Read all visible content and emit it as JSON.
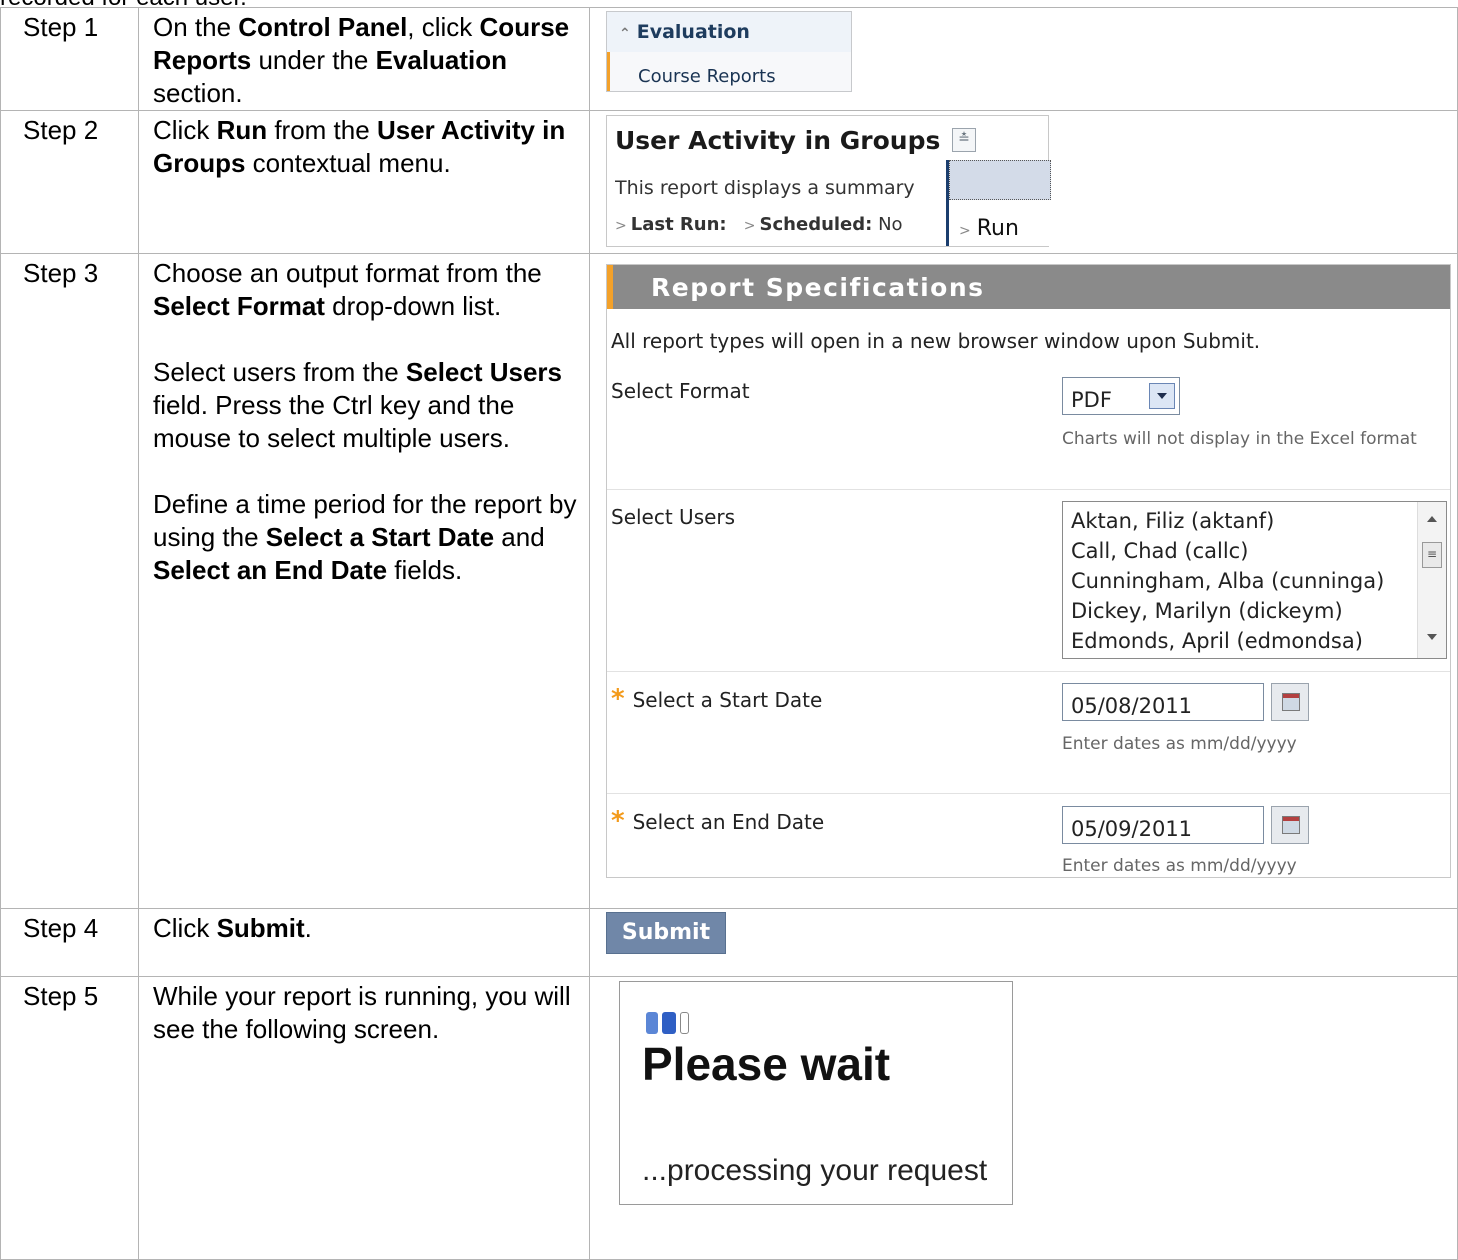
{
  "cut_line": "recorded for each user.",
  "steps": [
    {
      "label": "Step 1",
      "instruction": [
        "On the ",
        {
          "b": "Control Panel"
        },
        ", click ",
        {
          "b": "Course Reports"
        },
        " under the ",
        {
          "b": "Evaluation"
        },
        " section."
      ]
    },
    {
      "label": "Step 2",
      "instruction": [
        "Click ",
        {
          "b": "Run"
        },
        " from the ",
        {
          "b": "User Activity in Groups"
        },
        " contextual menu."
      ]
    },
    {
      "label": "Step 3",
      "paragraphs": [
        [
          "Choose an output format from the ",
          {
            "b": "Select Format"
          },
          " drop-down list."
        ],
        [
          "Select users from the ",
          {
            "b": "Select Users"
          },
          " field. Press the Ctrl key and the mouse to select multiple users."
        ],
        [
          "Define a time period for the report by using the ",
          {
            "b": "Select a Start Date"
          },
          " and ",
          {
            "b": "Select an End Date"
          },
          " fields."
        ]
      ]
    },
    {
      "label": "Step 4",
      "instruction": [
        "Click ",
        {
          "b": "Submit"
        },
        "."
      ]
    },
    {
      "label": "Step 5",
      "instruction": [
        "While your report is running, you will see the following screen."
      ]
    }
  ],
  "shot1": {
    "header": "Evaluation",
    "item": "Course Reports"
  },
  "shot2": {
    "title": "User Activity in Groups",
    "desc": "This report displays a summary",
    "last_run": "Last Run:",
    "scheduled": "Scheduled:",
    "scheduled_value": "No",
    "menu_item": "Run"
  },
  "shot3": {
    "header": "Report Specifications",
    "note": "All report types will open in a new browser window upon Submit.",
    "format_label": "Select Format",
    "format_value": "PDF",
    "format_hint": "Charts will not display in the Excel format",
    "users_label": "Select Users",
    "users": [
      "Aktan, Filiz (aktanf)",
      "Call, Chad (callc)",
      "Cunningham, Alba (cunninga)",
      "Dickey, Marilyn (dickeym)",
      "Edmonds, April (edmondsa)"
    ],
    "start_label": "Select a Start Date",
    "start_value": "05/08/2011",
    "end_label": "Select an End Date",
    "end_value": "05/09/2011",
    "date_hint": "Enter dates as mm/dd/yyyy",
    "required_mark": "*"
  },
  "shot4": {
    "submit_label": "Submit"
  },
  "shot5": {
    "title": "Please wait",
    "sub": "...processing your request"
  },
  "colors": {
    "accent": "#f3a12a",
    "header_gray": "#8a8a8a",
    "submit_blue": "#7087a8"
  }
}
